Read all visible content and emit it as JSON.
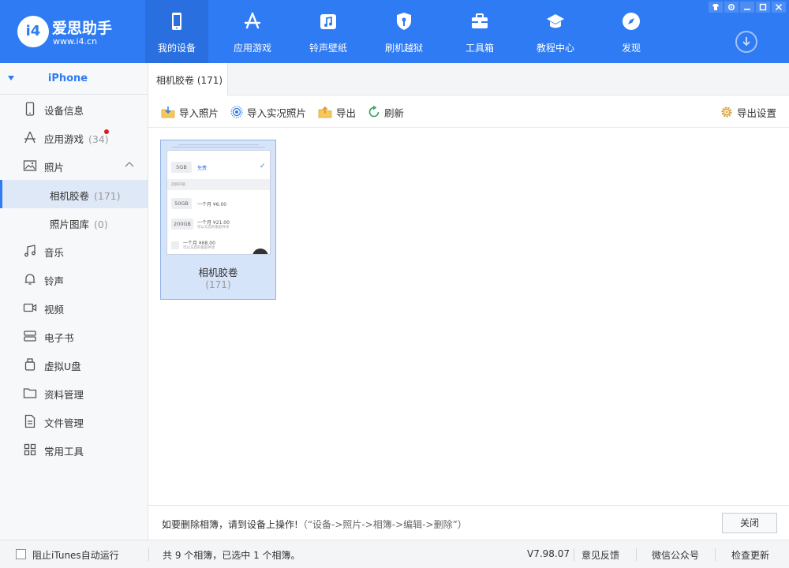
{
  "app": {
    "name": "爱思助手",
    "url": "www.i4.cn",
    "logo_text": "i4",
    "accent_color": "#2f7bf3"
  },
  "nav": [
    {
      "label": "我的设备",
      "icon": "phone-icon",
      "active": true
    },
    {
      "label": "应用游戏",
      "icon": "app-store-icon"
    },
    {
      "label": "铃声壁纸",
      "icon": "music-note-icon"
    },
    {
      "label": "刷机越狱",
      "icon": "shield-key-icon"
    },
    {
      "label": "工具箱",
      "icon": "toolbox-icon"
    },
    {
      "label": "教程中心",
      "icon": "graduation-cap-icon"
    },
    {
      "label": "发现",
      "icon": "compass-icon"
    }
  ],
  "sidebar": {
    "device": "iPhone",
    "items": [
      {
        "label": "设备信息",
        "icon": "phone-outline-icon"
      },
      {
        "label": "应用游戏",
        "count": "(34)",
        "icon": "app-store-outline-icon",
        "badge_dot": true
      },
      {
        "label": "照片",
        "icon": "image-icon",
        "expanded": true
      },
      {
        "label": "相机胶卷",
        "count": "(171)",
        "sub": true,
        "active": true
      },
      {
        "label": "照片图库",
        "count": "(0)",
        "sub": true
      },
      {
        "label": "音乐",
        "icon": "music-icon"
      },
      {
        "label": "铃声",
        "icon": "bell-icon"
      },
      {
        "label": "视频",
        "icon": "video-icon"
      },
      {
        "label": "电子书",
        "icon": "book-icon"
      },
      {
        "label": "虚拟U盘",
        "icon": "usb-drive-icon"
      },
      {
        "label": "资料管理",
        "icon": "folder-icon"
      },
      {
        "label": "文件管理",
        "icon": "file-icon"
      },
      {
        "label": "常用工具",
        "icon": "grid-icon"
      }
    ]
  },
  "tab": {
    "label": "相机胶卷 (171)"
  },
  "toolbar": {
    "import_photos": "导入照片",
    "import_live": "导入实况照片",
    "export": "导出",
    "refresh": "刷新",
    "export_settings": "导出设置"
  },
  "album": {
    "name": "相机胶卷",
    "count": "(171)",
    "thumb": {
      "row1_chip": "5GB",
      "row1_text": "免费",
      "section": "选择升级",
      "row2_chip": "50GB",
      "row2_text": "一个月 ¥6.00",
      "row3_chip": "200GB",
      "row3_text": "一个月 ¥21.00",
      "row3_sub": "可以与您的家庭共享",
      "row4_text": "一个月 ¥68.00",
      "row4_sub": "可以与您的家庭共享"
    }
  },
  "notice": {
    "text": "如要删除相簿，请到设备上操作!",
    "hint": "（“设备->照片->相簿->编辑->删除”）",
    "close_label": "关闭"
  },
  "status": {
    "itunes_checkbox": "阻止iTunes自动运行",
    "summary": "共 9 个相簿，已选中 1 个相簿。",
    "version": "V7.98.07",
    "feedback": "意见反馈",
    "wechat": "微信公众号",
    "update": "检查更新"
  }
}
